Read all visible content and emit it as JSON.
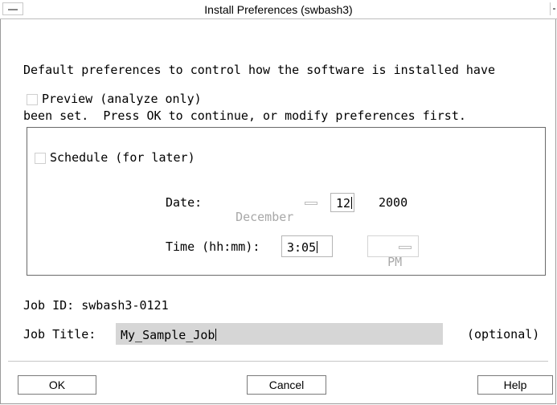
{
  "window": {
    "title": "Install Preferences (swbash3)",
    "menu_icon": "window-menu-icon",
    "close_icon": "window-close-icon"
  },
  "intro": {
    "line1": "Default preferences to control how the software is installed have",
    "line2": "been set.  Press OK to continue, or modify preferences first."
  },
  "preview": {
    "label": "Preview (analyze only)",
    "checked": false
  },
  "schedule": {
    "label": "Schedule (for later)",
    "checked": false,
    "date_label": "Date:",
    "month_value": "December",
    "day_value": "12",
    "year_value": "2000",
    "time_label": "Time (hh:mm):",
    "time_value": "3:05",
    "ampm_value": "PM"
  },
  "job": {
    "id_label": "Job ID:",
    "id_value": "swbash3-0121",
    "title_label": "Job Title:",
    "title_value": "My_Sample_Job",
    "optional_label": "(optional)"
  },
  "buttons": {
    "ok": "OK",
    "cancel": "Cancel",
    "help": "Help"
  }
}
